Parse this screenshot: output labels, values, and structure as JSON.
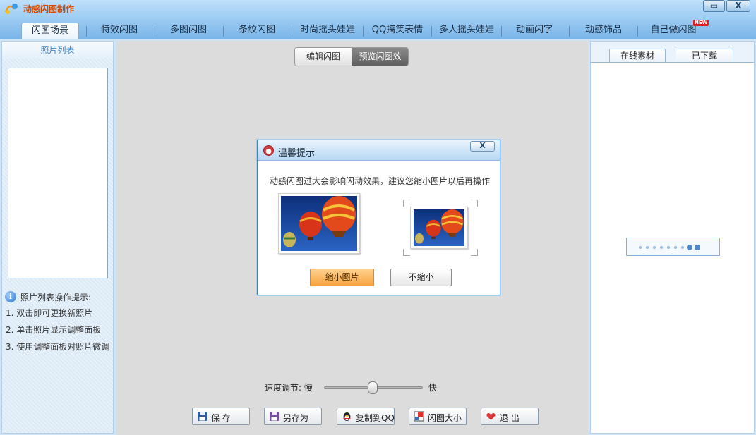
{
  "app": {
    "title": "动感闪图制作"
  },
  "window_controls": {
    "maximize": "▭",
    "close": "X"
  },
  "tabs": [
    {
      "label": "闪图场景",
      "active": true
    },
    {
      "label": "特效闪图"
    },
    {
      "label": "多图闪图"
    },
    {
      "label": "条纹闪图"
    },
    {
      "label": "时尚摇头娃娃"
    },
    {
      "label": "QQ搞笑表情"
    },
    {
      "label": "多人摇头娃娃"
    },
    {
      "label": "动画闪字"
    },
    {
      "label": "动感饰品"
    },
    {
      "label": "自己做闪图",
      "badge": "NEW"
    }
  ],
  "left_panel": {
    "header": "照片列表",
    "tips_title": "照片列表操作提示:",
    "tips": [
      "1. 双击即可更换新照片",
      "2. 单击照片显示调整面板",
      "3. 使用调整面板对照片微调"
    ]
  },
  "center": {
    "segments": {
      "edit": "编辑闪图",
      "preview": "预览闪图效果"
    },
    "speed": {
      "label": "速度调节:  慢",
      "fast": "快",
      "level": 0.47
    },
    "buttons": {
      "save": "保  存",
      "save_as": "另存为",
      "copy_qq": "复制到QQ",
      "size": "闪图大小",
      "exit": "退  出"
    }
  },
  "right_panel": {
    "tabs": {
      "online": "在线素材",
      "downloaded": "已下载"
    },
    "loading_dots": 9
  },
  "dialog": {
    "title": "温馨提示",
    "close": "X",
    "message": "动感闪图过大会影响闪动效果，建议您缩小图片以后再操作",
    "btn_shrink": "缩小图片",
    "btn_no_shrink": "不缩小"
  },
  "colors": {
    "accent": "#3a86c8",
    "title": "#d44a00",
    "primary_button": "#f6a43e"
  }
}
